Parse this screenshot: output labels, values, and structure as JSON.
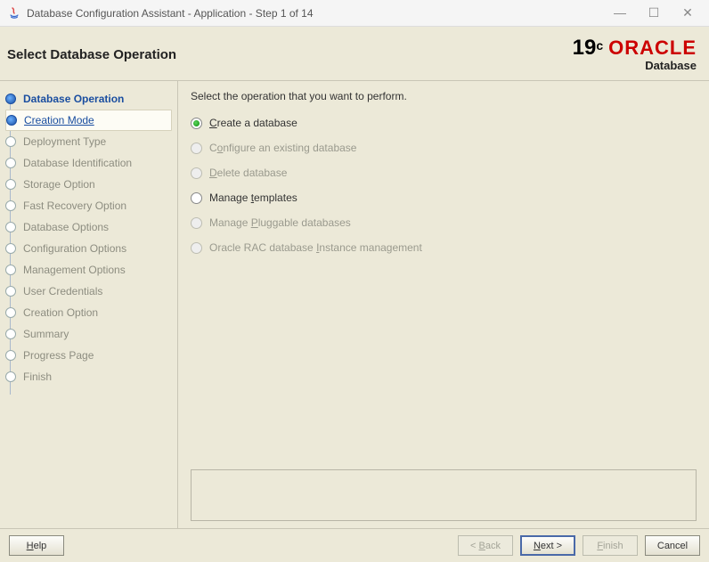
{
  "window": {
    "title": "Database Configuration Assistant - Application - Step 1 of 14"
  },
  "header": {
    "page_title": "Select Database Operation",
    "logo": {
      "version": "19",
      "sup": "c",
      "brand": "ORACLE",
      "product": "Database"
    }
  },
  "sidebar": {
    "steps": [
      {
        "label": "Database Operation",
        "state": "active"
      },
      {
        "label": "Creation Mode",
        "state": "current"
      },
      {
        "label": "Deployment Type",
        "state": "future"
      },
      {
        "label": "Database Identification",
        "state": "future"
      },
      {
        "label": "Storage Option",
        "state": "future"
      },
      {
        "label": "Fast Recovery Option",
        "state": "future"
      },
      {
        "label": "Database Options",
        "state": "future"
      },
      {
        "label": "Configuration Options",
        "state": "future"
      },
      {
        "label": "Management Options",
        "state": "future"
      },
      {
        "label": "User Credentials",
        "state": "future"
      },
      {
        "label": "Creation Option",
        "state": "future"
      },
      {
        "label": "Summary",
        "state": "future"
      },
      {
        "label": "Progress Page",
        "state": "future"
      },
      {
        "label": "Finish",
        "state": "future"
      }
    ]
  },
  "main": {
    "instruction": "Select the operation that you want to perform.",
    "options": [
      {
        "pre": "",
        "mn": "C",
        "post": "reate a database",
        "selected": true,
        "enabled": true
      },
      {
        "pre": "C",
        "mn": "o",
        "post": "nfigure an existing database",
        "selected": false,
        "enabled": false
      },
      {
        "pre": "",
        "mn": "D",
        "post": "elete database",
        "selected": false,
        "enabled": false
      },
      {
        "pre": "Manage ",
        "mn": "t",
        "post": "emplates",
        "selected": false,
        "enabled": true
      },
      {
        "pre": "Manage ",
        "mn": "P",
        "post": "luggable databases",
        "selected": false,
        "enabled": false
      },
      {
        "pre": "Oracle RAC database ",
        "mn": "I",
        "post": "nstance management",
        "selected": false,
        "enabled": false
      }
    ]
  },
  "footer": {
    "help": "Help",
    "back": "< Back",
    "next": "Next >",
    "finish": "Finish",
    "cancel": "Cancel"
  }
}
